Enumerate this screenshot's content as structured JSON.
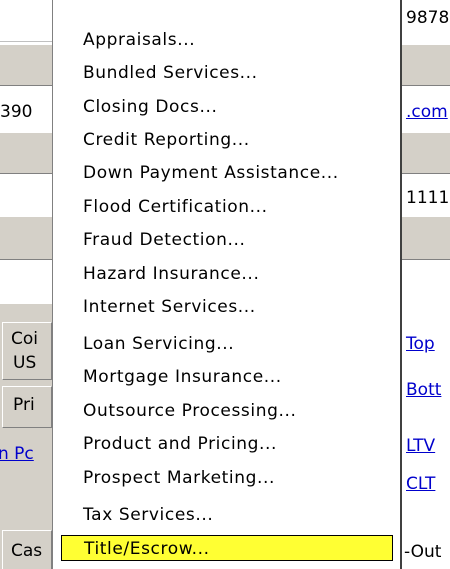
{
  "background": {
    "left_labels": {
      "row3": "390",
      "cor": "Coi",
      "us": "US",
      "pri": "Pri",
      "npc": "n Pc",
      "cas": "Cas"
    },
    "right_labels": {
      "row1": "9878",
      "row3": ".com",
      "row5": "1111",
      "top": "Top",
      "bott": "Bott",
      "ltv": "LTV",
      "clt": "CLT",
      "out": "-Out"
    }
  },
  "menu": {
    "items": [
      "Appraisals...",
      "Bundled Services...",
      "Closing Docs...",
      "Credit Reporting...",
      "Down Payment Assistance...",
      "Flood Certification...",
      "Fraud Detection...",
      "Hazard Insurance...",
      "Internet Services...",
      "Loan Servicing...",
      "Mortgage Insurance...",
      "Outsource Processing...",
      "Product and Pricing...",
      "Prospect Marketing...",
      "Tax Services...",
      "Title/Escrow..."
    ],
    "selected_index": 15,
    "highlight_color": "#ffff33"
  }
}
